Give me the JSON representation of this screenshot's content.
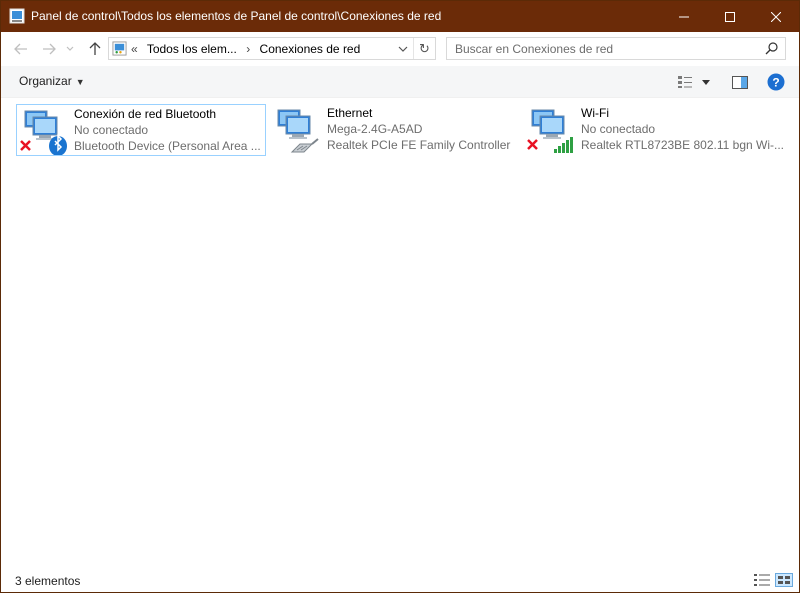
{
  "window": {
    "title": "Panel de control\\Todos los elementos de Panel de control\\Conexiones de red",
    "titlebar_color": "#6b2b08"
  },
  "address": {
    "overflow": "«",
    "crumbs": [
      "Todos los elem...",
      "Conexiones de red"
    ]
  },
  "search": {
    "placeholder": "Buscar en Conexiones de red"
  },
  "toolbar": {
    "organize_label": "Organizar"
  },
  "connections": [
    {
      "name": "Conexión de red Bluetooth",
      "status": "No conectado",
      "device": "Bluetooth Device (Personal Area ...",
      "icon": "bluetooth-network-icon",
      "disconnected": true
    },
    {
      "name": "Ethernet",
      "status": "Mega-2.4G-A5AD",
      "device": "Realtek PCIe FE Family Controller",
      "icon": "ethernet-network-icon",
      "disconnected": false
    },
    {
      "name": "Wi-Fi",
      "status": "No conectado",
      "device": "Realtek RTL8723BE 802.11 bgn Wi-...",
      "icon": "wifi-network-icon",
      "disconnected": true
    }
  ],
  "statusbar": {
    "count": "3 elementos"
  },
  "colors": {
    "accent": "#0078d7",
    "selection_border": "#99d1ff",
    "disconnected": "#e81123"
  }
}
